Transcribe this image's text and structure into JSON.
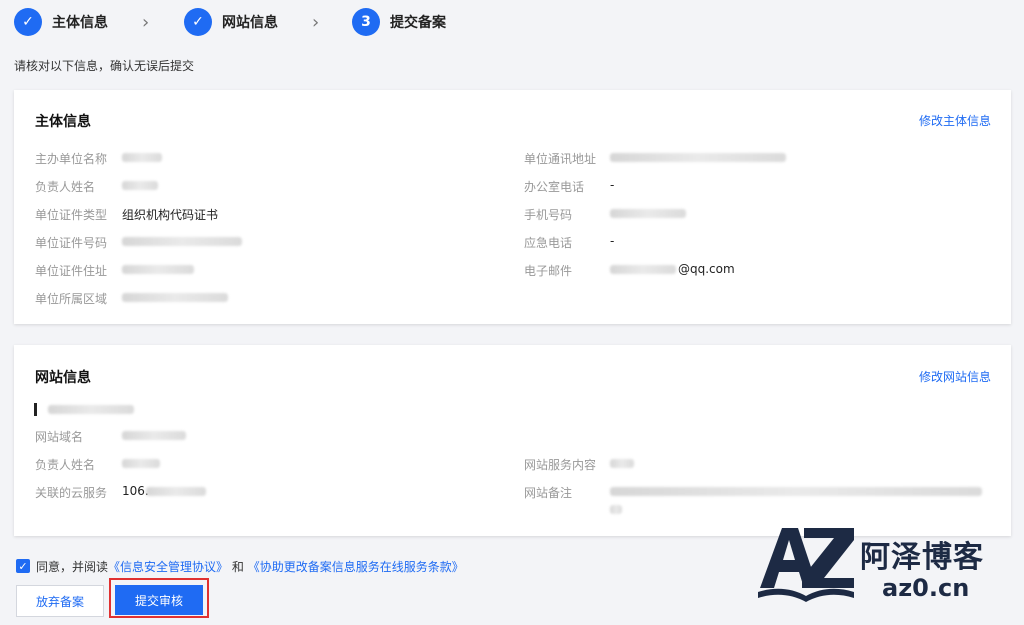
{
  "steps": [
    {
      "label": "主体信息",
      "state": "done"
    },
    {
      "label": "网站信息",
      "state": "done"
    },
    {
      "label": "提交备案",
      "state": "current",
      "number": "3"
    }
  ],
  "notice": "请核对以下信息，确认无误后提交",
  "subject": {
    "title": "主体信息",
    "edit_link": "修改主体信息",
    "left_fields": [
      {
        "label": "主办单位名称",
        "value": ""
      },
      {
        "label": "负责人姓名",
        "value": ""
      },
      {
        "label": "单位证件类型",
        "value": "组织机构代码证书"
      },
      {
        "label": "单位证件号码",
        "value": ""
      },
      {
        "label": "单位证件住址",
        "value": ""
      },
      {
        "label": "单位所属区域",
        "value": ""
      }
    ],
    "right_fields": [
      {
        "label": "单位通讯地址",
        "value": ""
      },
      {
        "label": "办公室电话",
        "value": "-"
      },
      {
        "label": "手机号码",
        "value": ""
      },
      {
        "label": "应急电话",
        "value": "-"
      },
      {
        "label": "电子邮件",
        "value": "@qq.com"
      }
    ]
  },
  "website": {
    "title": "网站信息",
    "edit_link": "修改网站信息",
    "site_name_prefix": "​",
    "left_fields": [
      {
        "label": "网站域名",
        "value": ""
      },
      {
        "label": "负责人姓名",
        "value": ""
      },
      {
        "label": "关联的云服务",
        "value": "106."
      }
    ],
    "right_fields": [
      {
        "label": "网站服务内容",
        "value": ""
      },
      {
        "label": "网站备注",
        "value": ""
      }
    ]
  },
  "agreement": {
    "prefix": "同意，并阅读",
    "link1": "《信息安全管理协议》",
    "middle": "和",
    "link2": "《协助更改备案信息服务在线服务条款》"
  },
  "buttons": {
    "abandon": "放弃备案",
    "submit": "提交审核"
  },
  "watermark": {
    "name": "阿泽博客",
    "url": "az0.cn"
  },
  "colors": {
    "accent": "#1f6bf3",
    "highlight": "#e03131"
  }
}
